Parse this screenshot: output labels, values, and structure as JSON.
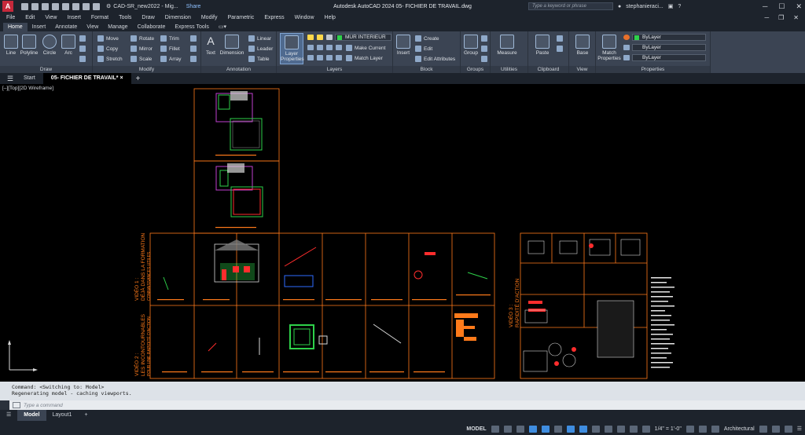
{
  "titlebar": {
    "logo": "A",
    "workspace": "CAD-SR_new2022 - Mig...",
    "share": "Share",
    "title": "Autodesk AutoCAD 2024   05- FICHIER DE TRAVAIL.dwg",
    "search_placeholder": "Type a keyword or phrase",
    "user": "stephanieraci...",
    "minimize": "─",
    "maximize": "☐",
    "close": "✕"
  },
  "menu": [
    "File",
    "Edit",
    "View",
    "Insert",
    "Format",
    "Tools",
    "Draw",
    "Dimension",
    "Modify",
    "Parametric",
    "Express",
    "Window",
    "Help"
  ],
  "ribbon_tabs": [
    "Home",
    "Insert",
    "Annotate",
    "View",
    "Manage",
    "Collaborate",
    "Express Tools"
  ],
  "ribbon": {
    "draw": {
      "title": "Draw",
      "line": "Line",
      "polyline": "Polyline",
      "circle": "Circle",
      "arc": "Arc"
    },
    "modify": {
      "title": "Modify",
      "move": "Move",
      "rotate": "Rotate",
      "trim": "Trim",
      "copy": "Copy",
      "mirror": "Mirror",
      "fillet": "Fillet",
      "stretch": "Stretch",
      "scale": "Scale",
      "array": "Array"
    },
    "annotation": {
      "title": "Annotation",
      "text": "Text",
      "dimension": "Dimension",
      "linear": "Linear",
      "leader": "Leader",
      "table": "Table"
    },
    "layers": {
      "title": "Layers",
      "layer_properties": "Layer Properties",
      "current_layer": "MUR INTERIEUR",
      "make_current": "Make Current",
      "match_layer": "Match Layer"
    },
    "block": {
      "title": "Block",
      "insert": "Insert",
      "create": "Create",
      "edit": "Edit",
      "edit_attributes": "Edit Attributes"
    },
    "groups": {
      "title": "Groups",
      "group": "Group"
    },
    "utilities": {
      "title": "Utilities",
      "measure": "Measure"
    },
    "clipboard": {
      "title": "Clipboard",
      "paste": "Paste"
    },
    "view": {
      "title": "View",
      "base": "Base"
    },
    "properties": {
      "title": "Properties",
      "match_properties": "Match Properties",
      "color": "ByLayer",
      "linetype": "ByLayer",
      "lineweight": "ByLayer"
    }
  },
  "file_tabs": [
    "Start",
    "05- FICHIER DE TRAVAIL*"
  ],
  "viewport_label": "[–][Top][2D Wireframe]",
  "drawing_text": {
    "video1": "VIDÉO 1 :",
    "video1_sub": "DÉJÀ DANS LA FORMATION",
    "video1_sub2": "CONNAISSANCES UTILES",
    "video2": "VIDÉO 2 :",
    "video2_sub": "LES INCONTOURNABLES",
    "video2_sub2": "POUR UNE RAPIDITÉ D'ACTION",
    "video3": "VIDÉO 3 :",
    "video3_sub": "RAPIDITÉ D'ACTION"
  },
  "command": {
    "line1": "Command:   <Switching to: Model>",
    "line2": "Regenerating model - caching viewports.",
    "placeholder": "Type a command"
  },
  "layout_tabs": [
    "Model",
    "Layout1"
  ],
  "status": {
    "model": "MODEL",
    "scale": "1/4\" = 1'-0\"",
    "units": "Architectural"
  },
  "colors": {
    "accent_blue": "#3f8de0",
    "frame_orange": "#ff7a1a",
    "layer_green": "#2ed14a",
    "title_red": "#c6293b"
  }
}
